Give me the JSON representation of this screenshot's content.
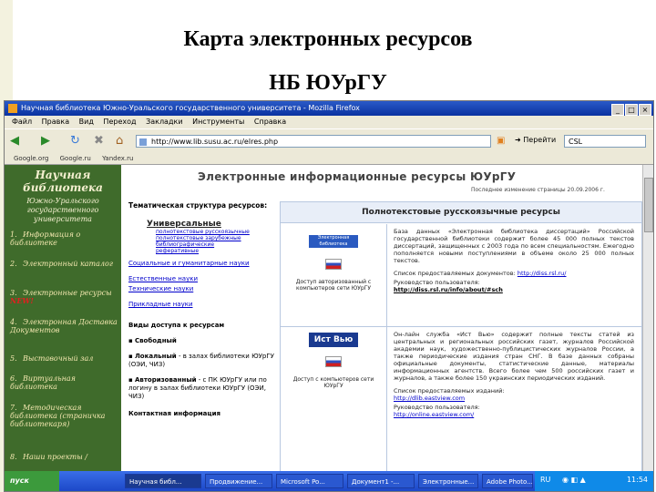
{
  "slide": {
    "title_line1": "Карта электронных ресурсов",
    "title_line2": "НБ ЮУрГУ"
  },
  "browser": {
    "window_title": "Научная библиотека Южно-Уральского государственного университета - Mozilla Firefox",
    "menu": [
      "Файл",
      "Правка",
      "Вид",
      "Переход",
      "Закладки",
      "Инструменты",
      "Справка"
    ],
    "url": "http://www.lib.susu.ac.ru/elres.php",
    "go_label": "Перейти",
    "search_value": "CSL",
    "bookmarks": [
      "Google.org",
      "Google.ru",
      "Yandex.ru"
    ]
  },
  "taskbar": {
    "start_label": "пуск",
    "tasks": [
      "Научная библ...",
      "Продвижение...",
      "Microsoft Po...",
      "Документ1 -...",
      "Электронные...",
      "Adobe Photo..."
    ],
    "tray_lang": "RU",
    "clock": "11:54"
  },
  "sidebar": {
    "logo_title": "Научная библиотека",
    "logo_subtitle": "Южно-Уральского государственного университета",
    "items": [
      {
        "num": "1.",
        "label": "Информация о библиотеке",
        "badge": ""
      },
      {
        "num": "2.",
        "label": "Электронный каталог",
        "badge": ""
      },
      {
        "num": "3.",
        "label": "Электронные ресурсы",
        "badge": "NEW!"
      },
      {
        "num": "4.",
        "label": "Электронная Доставка Документов",
        "badge": ""
      },
      {
        "num": "5.",
        "label": "Выставочный зал",
        "badge": ""
      },
      {
        "num": "6.",
        "label": "Виртуальная библиотека",
        "badge": ""
      },
      {
        "num": "7.",
        "label": "Методическая библиотека (страничка библиотекаря)",
        "badge": ""
      },
      {
        "num": "8.",
        "label": "Наши проекты /",
        "badge": ""
      }
    ]
  },
  "page": {
    "header": "Электронные информационные ресурсы ЮУрГУ",
    "updated": "Последнее изменение страницы 20.09.2006 г.",
    "left": {
      "section_title": "Тематическая структура ресурсов:",
      "universal_title": "Универсальные",
      "universal_lines": [
        "полнотекстовые русскоязычные",
        "полнотекстовые зарубежные",
        "библиографические",
        "реферативные"
      ],
      "links": [
        "Социальные и гуманитарные науки",
        "Естественные науки",
        "Технические науки",
        "Прикладные науки"
      ],
      "access_title": "Виды доступа к ресурсам",
      "access_items": [
        {
          "bold": "Свободный",
          "rest": ""
        },
        {
          "bold": "Локальный",
          "rest": " - в залах библиотеки ЮУрГУ (ОЭИ, ЧИЗ)"
        },
        {
          "bold": "Авторизованный",
          "rest": " - с ПК ЮУрГУ или по логину в залах библиотеки ЮУрГУ (ОЭИ, ЧИЗ)"
        }
      ],
      "contact": "Контактная информация"
    },
    "right": {
      "title": "Полнотекстовые русскоязычные ресурсы",
      "resources": [
        {
          "logo_label": "Электронная библиотека диссертаций",
          "access": "Доступ авторизованный с компьютеров сети ЮУрГУ",
          "text": "База данных «Электронная библиотека диссертаций» Российской государственной библиотеки содержит более 45 000 полных текстов диссертаций, защищенных с 2003 года по всем специальностям. Ежегодно пополняется новыми поступлениями в объеме около 25 000 полных текстов.",
          "contact_label": "Список предоставляемых документов:",
          "link": "http://diss.rsl.ru/",
          "guide_label": "Руководство пользователя:",
          "guide_link": "http://diss.rsl.ru/info/about/#sch"
        },
        {
          "logo_label": "Ист Вью",
          "access": "Доступ с компьютеров сети ЮУрГУ",
          "text": "Он-лайн служба «Ист Вью» содержит полные тексты статей из центральных и региональных российских газет, журналов Российской академии наук, художественно-публицистических журналов России, а также периодические издания стран СНГ. В базе данных собраны официальные документы, статистические данные, материалы информационных агентств. Всего более чем 500 российских газет и журналов, а также более 150 украинских периодических изданий.",
          "contact_label": "Список предоставляемых изданий:",
          "link": "http://dlib.eastview.com",
          "guide_label": "Руководство пользователя:",
          "guide_link": "http://online.eastview.com/"
        }
      ]
    }
  }
}
